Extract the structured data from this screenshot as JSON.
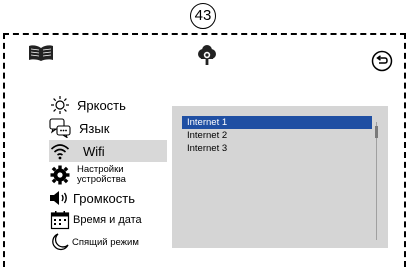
{
  "page_number": "43",
  "top_bar": {
    "left_icon": "open-book-icon",
    "center_icon": "settings-cloud-icon",
    "right_icon": "back-arrow-icon"
  },
  "menu": {
    "items": [
      {
        "id": "brightness",
        "label": "Яркость",
        "icon": "sun-icon"
      },
      {
        "id": "language",
        "label": "Язык",
        "icon": "speech-bubble-icon"
      },
      {
        "id": "wifi",
        "label": "Wifi",
        "icon": "wifi-icon",
        "active": true
      },
      {
        "id": "device-settings",
        "label_line1": "Настройки",
        "label_line2": "устройства",
        "icon": "gear-icon"
      },
      {
        "id": "volume",
        "label": "Громкость",
        "icon": "speaker-icon"
      },
      {
        "id": "datetime",
        "label": "Время и дата",
        "icon": "calendar-icon"
      },
      {
        "id": "sleep",
        "label": "Спящий режим",
        "icon": "moon-icon"
      }
    ]
  },
  "wifi_panel": {
    "networks": [
      "Internet 1",
      "Internet 2",
      "Internet 3"
    ],
    "selected_index": 0
  },
  "colors": {
    "panel_bg": "#d5d5d5",
    "selection": "#1f4fa3",
    "active_menu_bg": "#d8d8d8"
  }
}
